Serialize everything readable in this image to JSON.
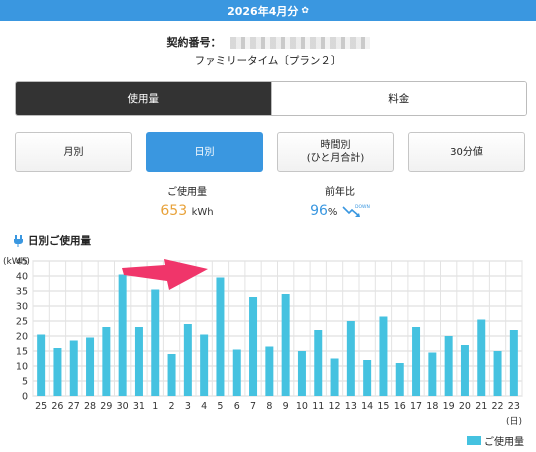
{
  "header": {
    "title": "2026年4月分",
    "gear_icon": "gear-icon"
  },
  "contract": {
    "label": "契約番号：",
    "plan": "ファミリータイム〔プラン２〕"
  },
  "segment": {
    "usage": "使用量",
    "fee": "料金"
  },
  "buttons": {
    "monthly": "月別",
    "daily": "日別",
    "hourly_line1": "時間別",
    "hourly_line2": "(ひと月合計)",
    "min30": "30分値"
  },
  "stats": {
    "usage_label": "ご使用量",
    "usage_value": "653",
    "usage_unit": "kWh",
    "yoy_label": "前年比",
    "yoy_value": "96",
    "yoy_unit": "%",
    "trend_text": "DOWN"
  },
  "colors": {
    "accent": "#3a97e0",
    "bar": "#45c2e0",
    "value_orange": "#e8a23a",
    "arrow": "#f0356a"
  },
  "chart_title": "日別ご使用量",
  "legend_label": "ご使用量",
  "chart_data": {
    "type": "bar",
    "ylabel": "(kWh)",
    "xlabel": "(日)",
    "ylim": [
      0,
      45
    ],
    "yticks": [
      0,
      5,
      10,
      15,
      20,
      25,
      30,
      35,
      40,
      45
    ],
    "grid": true,
    "legend": "bottom-right",
    "categories": [
      "25",
      "26",
      "27",
      "28",
      "29",
      "30",
      "31",
      "1",
      "2",
      "3",
      "4",
      "5",
      "6",
      "7",
      "8",
      "9",
      "10",
      "11",
      "12",
      "13",
      "14",
      "15",
      "16",
      "17",
      "18",
      "19",
      "20",
      "21",
      "22",
      "23"
    ],
    "series": [
      {
        "name": "ご使用量",
        "values": [
          20.5,
          16,
          18.5,
          19.5,
          23,
          40.5,
          23,
          35.5,
          14,
          24,
          20.5,
          39.5,
          15.5,
          33,
          16.5,
          34,
          15,
          22,
          12.5,
          25,
          12,
          26.5,
          11,
          23,
          14.5,
          20,
          17,
          25.5,
          15,
          22
        ]
      }
    ]
  }
}
